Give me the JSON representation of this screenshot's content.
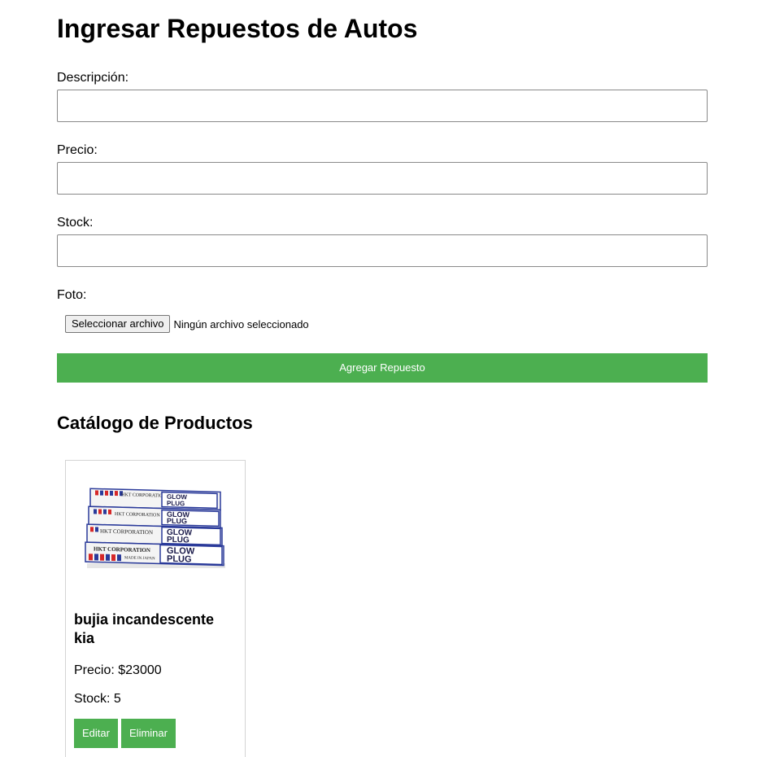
{
  "form": {
    "title": "Ingresar Repuestos de Autos",
    "description_label": "Descripción:",
    "description_value": "",
    "price_label": "Precio:",
    "price_value": "",
    "stock_label": "Stock:",
    "stock_value": "",
    "photo_label": "Foto:",
    "file_button_label": "Seleccionar archivo",
    "file_status": "Ningún archivo seleccionado",
    "submit_label": "Agregar Repuesto"
  },
  "catalog": {
    "title": "Catálogo de Productos",
    "products": [
      {
        "name": "bujia incandescente kia",
        "price_text": "Precio: $23000",
        "stock_text": "Stock: 5",
        "image": {
          "icon": "glow-plug-boxes-photo",
          "box_texts": [
            "HKT CORPORATION",
            "MADE IN JAPAN",
            "GLOW",
            "PLUG"
          ]
        },
        "edit_label": "Editar",
        "delete_label": "Eliminar"
      }
    ]
  },
  "colors": {
    "accent": "#4caf50",
    "button_text": "#ffffff",
    "card_border": "#d4d4d4",
    "input_border": "#8a8a8a"
  }
}
